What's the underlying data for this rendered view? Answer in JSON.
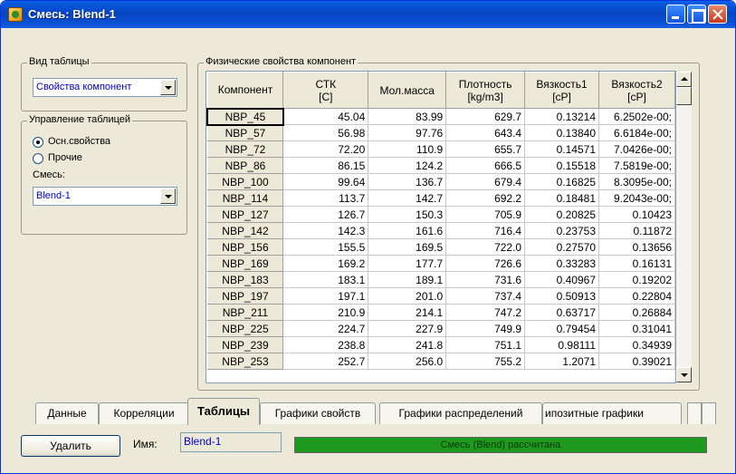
{
  "window": {
    "title": "Смесь: Blend-1",
    "icon": "blend-app-icon"
  },
  "view_group": {
    "legend": "Вид таблицы",
    "selected": "Свойства компонент"
  },
  "manage_group": {
    "legend": "Управление таблицей",
    "radios": [
      {
        "label": "Осн.свойства",
        "checked": true
      },
      {
        "label": "Прочие",
        "checked": false
      }
    ],
    "blend_label": "Смесь:",
    "blend_selected": "Blend-1"
  },
  "props_group": {
    "legend": "Физические свойства компонент",
    "columns": [
      [
        "Компонент",
        ""
      ],
      [
        "СТК",
        "[C]"
      ],
      [
        "Мол.масса",
        ""
      ],
      [
        "Плотность",
        "[kg/m3]"
      ],
      [
        "Вязкость1",
        "[cP]"
      ],
      [
        "Вязкость2",
        "[cP]"
      ]
    ],
    "rows": [
      [
        "NBP_45",
        "45.04",
        "83.99",
        "629.7",
        "0.13214",
        "6.2502e-00;"
      ],
      [
        "NBP_57",
        "56.98",
        "97.76",
        "643.4",
        "0.13840",
        "6.6184e-00;"
      ],
      [
        "NBP_72",
        "72.20",
        "110.9",
        "655.7",
        "0.14571",
        "7.0426e-00;"
      ],
      [
        "NBP_86",
        "86.15",
        "124.2",
        "666.5",
        "0.15518",
        "7.5819e-00;"
      ],
      [
        "NBP_100",
        "99.64",
        "136.7",
        "679.4",
        "0.16825",
        "8.3095e-00;"
      ],
      [
        "NBP_114",
        "113.7",
        "142.7",
        "692.2",
        "0.18481",
        "9.2043e-00;"
      ],
      [
        "NBP_127",
        "126.7",
        "150.3",
        "705.9",
        "0.20825",
        "0.10423"
      ],
      [
        "NBP_142",
        "142.3",
        "161.6",
        "716.4",
        "0.23753",
        "0.11872"
      ],
      [
        "NBP_156",
        "155.5",
        "169.5",
        "722.0",
        "0.27570",
        "0.13656"
      ],
      [
        "NBP_169",
        "169.2",
        "177.7",
        "726.6",
        "0.33283",
        "0.16131"
      ],
      [
        "NBP_183",
        "183.1",
        "189.1",
        "731.6",
        "0.40967",
        "0.19202"
      ],
      [
        "NBP_197",
        "197.1",
        "201.0",
        "737.4",
        "0.50913",
        "0.22804"
      ],
      [
        "NBP_211",
        "210.9",
        "214.1",
        "747.2",
        "0.63717",
        "0.26884"
      ],
      [
        "NBP_225",
        "224.7",
        "227.9",
        "749.9",
        "0.79454",
        "0.31041"
      ],
      [
        "NBP_239",
        "238.8",
        "241.8",
        "751.1",
        "0.98111",
        "0.34939"
      ],
      [
        "NBP_253",
        "252.7",
        "256.0",
        "755.2",
        "1.2071",
        "0.39021"
      ]
    ],
    "selected_row": 0
  },
  "tabs": [
    {
      "label": "Данные",
      "active": false
    },
    {
      "label": "Корреляции",
      "active": false
    },
    {
      "label": "Таблицы",
      "active": true
    },
    {
      "label": "Графики свойств",
      "active": false
    },
    {
      "label": "Графики распределений",
      "active": false
    },
    {
      "label": "ипозитные графики",
      "active": false
    }
  ],
  "footer": {
    "delete_label": "Удалить",
    "name_label": "Имя:",
    "name_value": "Blend-1",
    "status_text": "Смесь (Blend) рассчитана",
    "status_color": "#1d9a1d"
  }
}
